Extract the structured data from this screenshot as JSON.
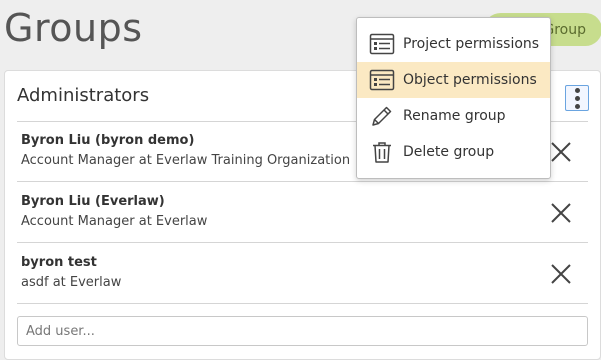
{
  "page": {
    "title": "Groups"
  },
  "header": {
    "add_group_label": "Group"
  },
  "group": {
    "name": "Administrators",
    "members": [
      {
        "name": "Byron Liu (byron demo)",
        "title": "Account Manager at Everlaw Training Organization"
      },
      {
        "name": "Byron Liu (Everlaw)",
        "title": "Account Manager at Everlaw"
      },
      {
        "name": "byron test",
        "title": "asdf at Everlaw"
      }
    ],
    "add_user_placeholder": "Add user..."
  },
  "menu": {
    "items": [
      {
        "label": "Project permissions",
        "icon": "permissions-list-icon"
      },
      {
        "label": "Object permissions",
        "icon": "permissions-list-icon",
        "highlighted": true
      },
      {
        "label": "Rename group",
        "icon": "pencil-icon"
      },
      {
        "label": "Delete group",
        "icon": "trash-icon"
      }
    ]
  },
  "colors": {
    "add_group_bg": "#c7dd8d",
    "menu_highlight": "#fbe9c3",
    "focus_border": "#6aa4e0"
  }
}
